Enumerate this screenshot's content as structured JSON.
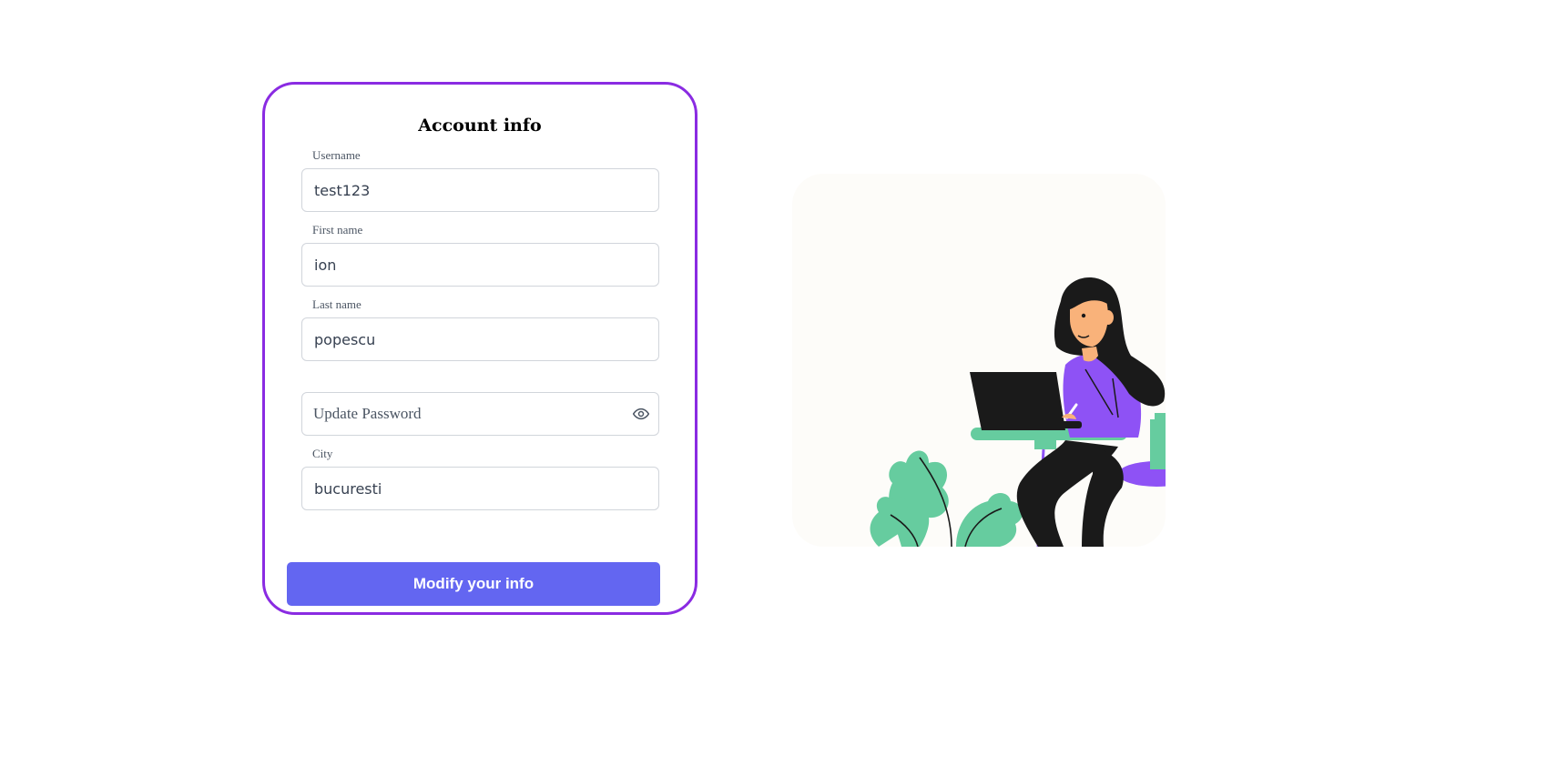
{
  "form": {
    "title": "Account info",
    "username": {
      "label": "Username",
      "value": "test123"
    },
    "first_name": {
      "label": "First name",
      "value": "ion"
    },
    "last_name": {
      "label": "Last name",
      "value": "popescu"
    },
    "password": {
      "placeholder": "Update Password",
      "value": ""
    },
    "city": {
      "label": "City",
      "value": "bucuresti"
    },
    "submit_label": "Modify your info"
  },
  "colors": {
    "card_border": "#8a2be2",
    "button": "#6366f1",
    "illustration_bg": "#fdfcf9",
    "plant_green": "#66cc9f",
    "shirt_purple": "#8e52f5"
  },
  "icons": {
    "password_toggle": "eye-icon"
  }
}
